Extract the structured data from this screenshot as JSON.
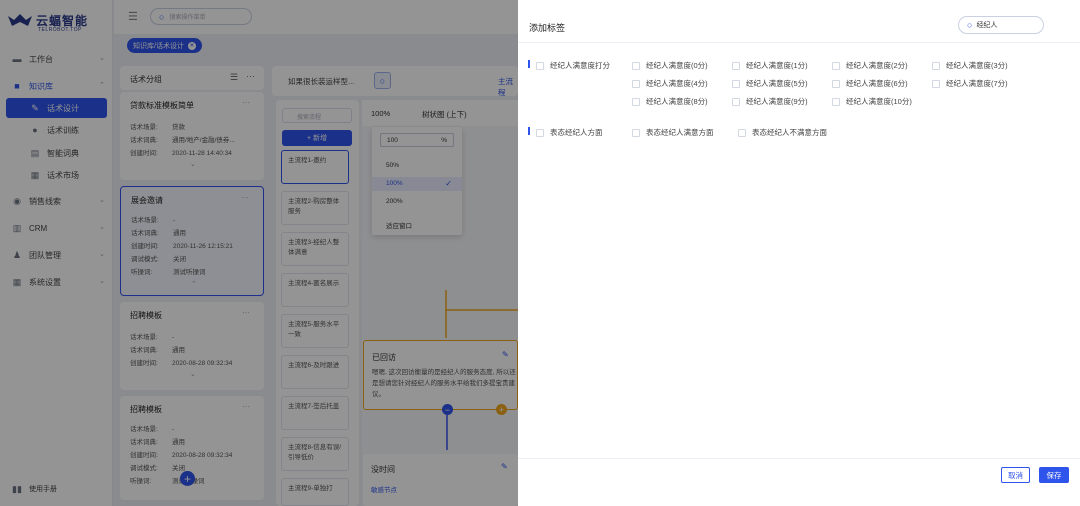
{
  "logo": {
    "name": "云蝠智能",
    "sub": "TELROBOT.TOP"
  },
  "search": {
    "placeholder": "搜索操作菜单"
  },
  "sidebar": {
    "items": [
      {
        "label": "工作台",
        "icon": "monitor-icon"
      },
      {
        "label": "知识库",
        "icon": "book-icon"
      },
      {
        "label": "话术设计",
        "icon": "edit-icon"
      },
      {
        "label": "话术训练",
        "icon": "train-icon"
      },
      {
        "label": "智能词典",
        "icon": "dictionary-icon"
      },
      {
        "label": "话术市场",
        "icon": "market-icon"
      },
      {
        "label": "销售线索",
        "icon": "lead-icon"
      },
      {
        "label": "CRM",
        "icon": "crm-icon"
      },
      {
        "label": "团队管理",
        "icon": "team-icon"
      },
      {
        "label": "系统设置",
        "icon": "settings-icon"
      }
    ],
    "manual": "使用手册"
  },
  "breadcrumb_tag": "知识库/话术设计",
  "group_panel": {
    "title": "话术分组"
  },
  "cards": [
    {
      "title": "贷款标准模板简单",
      "rows": [
        [
          "话术场景:",
          "贷款"
        ],
        [
          "话术词典:",
          "通用/地产/金融/债券..."
        ],
        [
          "创建时间:",
          "2020-11-28 14:40:34"
        ]
      ]
    },
    {
      "title": "展会邀请",
      "rows": [
        [
          "话术场景:",
          "-"
        ],
        [
          "话术词典:",
          "通用"
        ],
        [
          "创建时间:",
          "2020-11-26 12:15:21"
        ],
        [
          "调试模式:",
          "关闭"
        ],
        [
          "听操词:",
          "测试听操词"
        ]
      ]
    },
    {
      "title": "招聘模板",
      "rows": [
        [
          "话术场景:",
          "-"
        ],
        [
          "话术词典:",
          "通用"
        ],
        [
          "创建时间:",
          "2020-08-28 09:32:34"
        ]
      ]
    },
    {
      "title": "招聘模板",
      "rows": [
        [
          "话术场景:",
          "-"
        ],
        [
          "话术词典:",
          "通用"
        ],
        [
          "创建时间:",
          "2020-08-28 09:32:34"
        ],
        [
          "调试模式:",
          "关闭"
        ],
        [
          "听操词:",
          "测试听操词"
        ]
      ]
    }
  ],
  "flow": {
    "select": "如果很长装运样型...",
    "tab": "主流程",
    "search_placeholder": "搜索流程",
    "add": "+ 新增",
    "zoom": "100%",
    "tree": "树状图 (上下)",
    "zoom_input": "100",
    "zoom_unit": "%",
    "zoom_options": [
      "50%",
      "100%",
      "200%",
      "适应窗口"
    ],
    "items": [
      "主流程1-邀约",
      "主流程2-购房整体服务",
      "主流程3-经纪人整体满意",
      "主流程4-匿名展示",
      "主流程5-服务水平一致",
      "主流程6-及时跟进",
      "主流程7-签后托盖",
      "主流程8-信息有误/引导低价",
      "主流程9-单独打"
    ],
    "node1": {
      "title": "已回访",
      "text": "嗯嗯, 这次回访衡量的是经纪人的服务态度, 所以还是想请您针对经纪人的服务水平给我们多提宝贵建议。"
    },
    "node2": {
      "title": "没时间",
      "sub": "敏感节点"
    }
  },
  "drawer": {
    "title": "添加标签",
    "search_value": "经纪人",
    "group1": {
      "head": "经纪人满意度打分",
      "options": [
        "经纪人满意度(0分)",
        "经纪人满意度(1分)",
        "经纪人满意度(2分)",
        "经纪人满意度(3分)",
        "经纪人满意度(4分)",
        "经纪人满意度(5分)",
        "经纪人满意度(6分)",
        "经纪人满意度(7分)",
        "经纪人满意度(8分)",
        "经纪人满意度(9分)",
        "经纪人满意度(10分)"
      ]
    },
    "group2": {
      "head": "表态经纪人方面",
      "options": [
        "表态经纪人满意方面",
        "表态经纪人不满意方面"
      ]
    },
    "cancel": "取消",
    "save": "保存"
  }
}
